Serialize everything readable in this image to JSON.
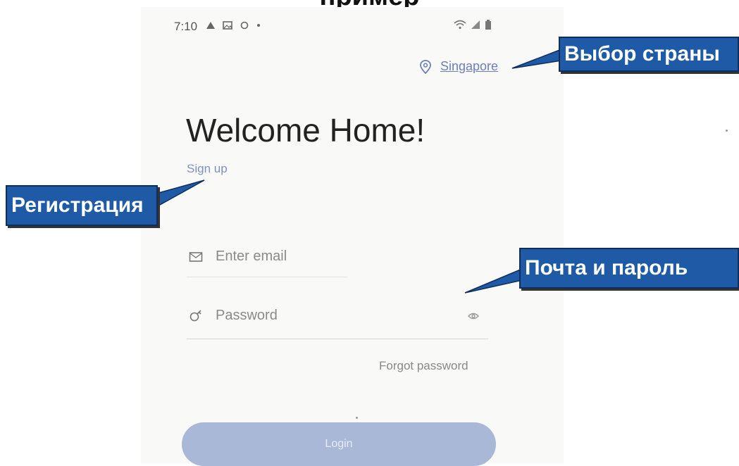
{
  "header": {
    "title": "пример"
  },
  "status_bar": {
    "time": "7:10"
  },
  "country": {
    "label": "Singapore"
  },
  "main": {
    "welcome": "Welcome Home!",
    "signup_label": "Sign up",
    "email_placeholder": "Enter email",
    "password_placeholder": "Password",
    "forgot_label": "Forgot password",
    "login_label": "Login"
  },
  "callouts": {
    "country": "Выбор страны",
    "signup": "Регистрация",
    "credentials": "Почта и пароль"
  },
  "colors": {
    "callout_bg": "#1f5aa6",
    "login_bg": "#aab8d8",
    "link": "#6c7fb8"
  },
  "icons": [
    "location-pin-icon",
    "mail-icon",
    "lock-icon",
    "eye-icon",
    "wifi-icon",
    "signal-icon",
    "battery-icon"
  ]
}
